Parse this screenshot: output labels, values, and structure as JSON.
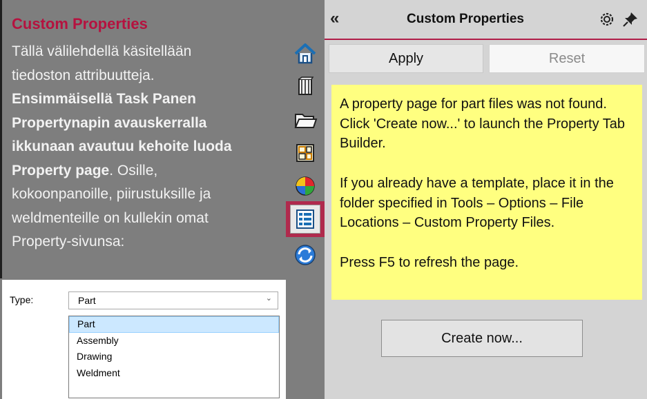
{
  "slide": {
    "heading": "Custom Properties",
    "line1": "Tällä välilehdellä käsitellään",
    "line2": "tiedoston attribuutteja.",
    "bold1": "Ensimmäisellä Task Panen",
    "bold2": "Propertynapin avauskerralla",
    "bold3": "ikkunaan avautuu kehoite luoda",
    "bold4": "Property page",
    "tail4": ".  Osille,",
    "line5": "kokoonpanoille, piirustuksille ja",
    "line6": "weldmenteille on kullekin omat",
    "line7": "Property-sivunsa:"
  },
  "type_dropdown": {
    "label": "Type:",
    "selected": "Part",
    "options": [
      "Part",
      "Assembly",
      "Drawing",
      "Weldment"
    ]
  },
  "tabs": [
    {
      "name": "home-icon"
    },
    {
      "name": "design-library-icon"
    },
    {
      "name": "file-explorer-icon"
    },
    {
      "name": "view-palette-icon"
    },
    {
      "name": "appearances-icon"
    },
    {
      "name": "custom-properties-icon",
      "active": true
    },
    {
      "name": "solidworks-forum-icon"
    }
  ],
  "pane": {
    "title": "Custom Properties",
    "apply_label": "Apply",
    "reset_label": "Reset",
    "msg1": "A property page for part files was not found. Click 'Create now...' to launch the Property Tab Builder.",
    "msg2": "If you already have a template, place it in the folder specified in Tools – Options – File Locations – Custom Property Files.",
    "msg3": "Press F5 to refresh the page.",
    "create_label": "Create now..."
  },
  "colors": {
    "accent": "#b01c47",
    "message_bg": "#ffff80",
    "slide_bg": "#7e7e7e"
  }
}
